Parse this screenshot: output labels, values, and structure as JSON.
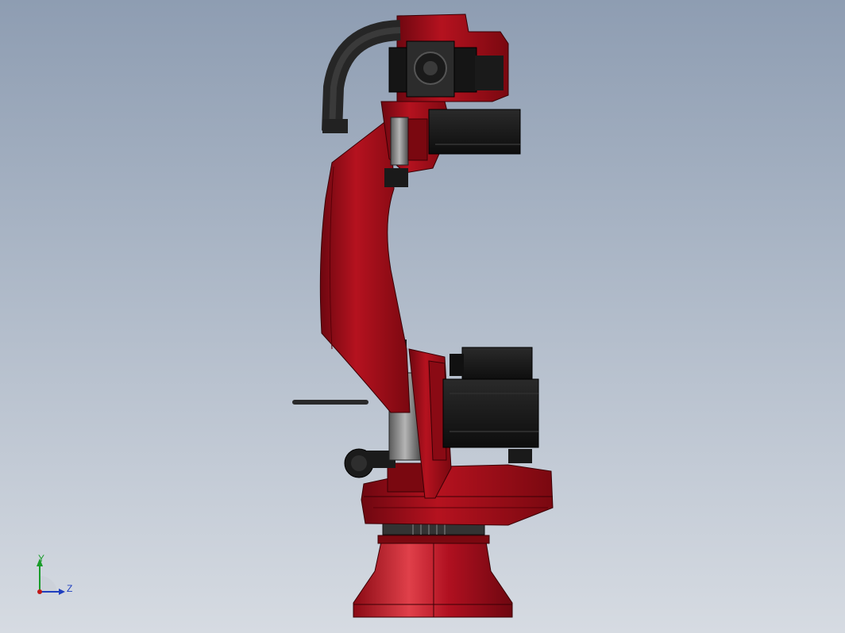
{
  "viewport": {
    "background_top": "#8e9db2",
    "background_bottom": "#d6dbe2"
  },
  "model": {
    "body_color": "#b01020",
    "body_shadow": "#7a0810",
    "motor_color": "#1a1a1a",
    "grey_color": "#7d7d7d",
    "hose_color": "#2a2a2a"
  },
  "triad": {
    "y_label": "Y",
    "z_label": "Z",
    "y_color": "#1a9c2a",
    "z_color": "#1f3fbf",
    "origin_color": "#c01818"
  }
}
